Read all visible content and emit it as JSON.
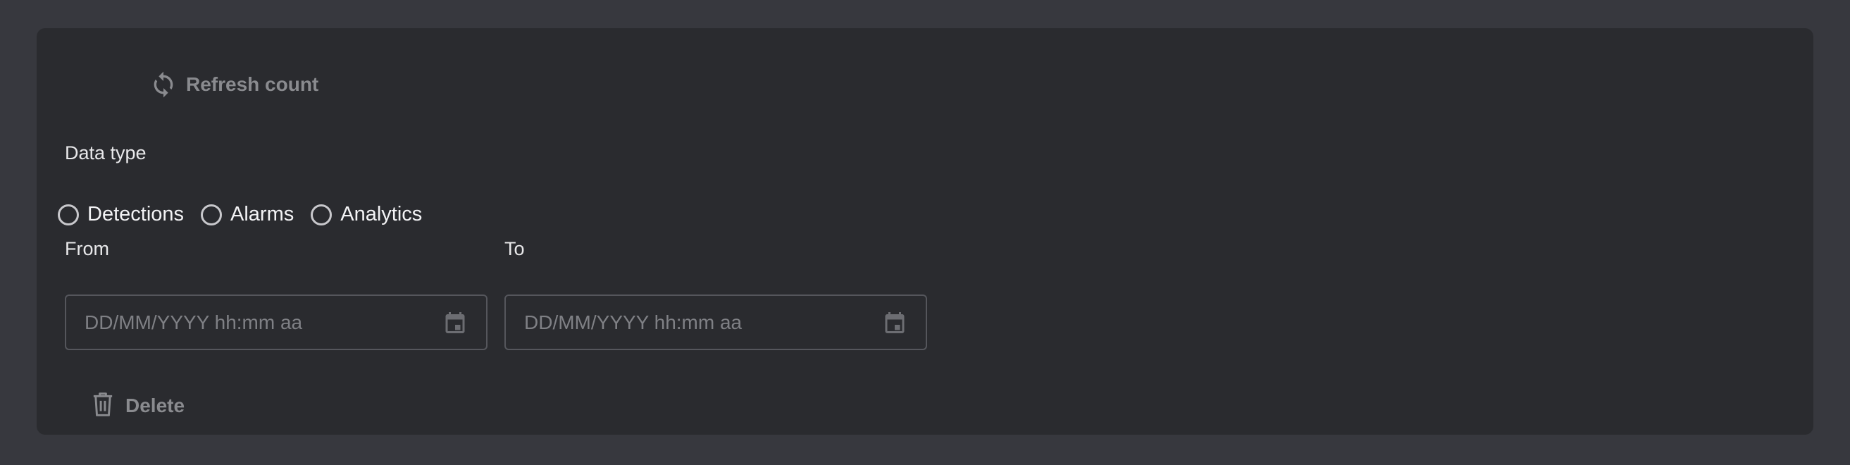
{
  "actions": {
    "refresh_label": "Refresh count",
    "delete_label": "Delete"
  },
  "data_type": {
    "label": "Data type",
    "options": [
      {
        "label": "Detections",
        "selected": false
      },
      {
        "label": "Alarms",
        "selected": false
      },
      {
        "label": "Analytics",
        "selected": false
      }
    ]
  },
  "date_range": {
    "from_label": "From",
    "from_placeholder": "DD/MM/YYYY hh:mm aa",
    "from_value": "",
    "to_label": "To",
    "to_placeholder": "DD/MM/YYYY hh:mm aa",
    "to_value": ""
  },
  "icons": {
    "refresh": "refresh-icon",
    "calendar": "calendar-icon",
    "delete": "trash-icon"
  },
  "colors": {
    "page_background": "#37383e",
    "card_background": "#2a2b2f",
    "muted_text": "#8a8b8f",
    "primary_text": "#f3f3f5"
  }
}
